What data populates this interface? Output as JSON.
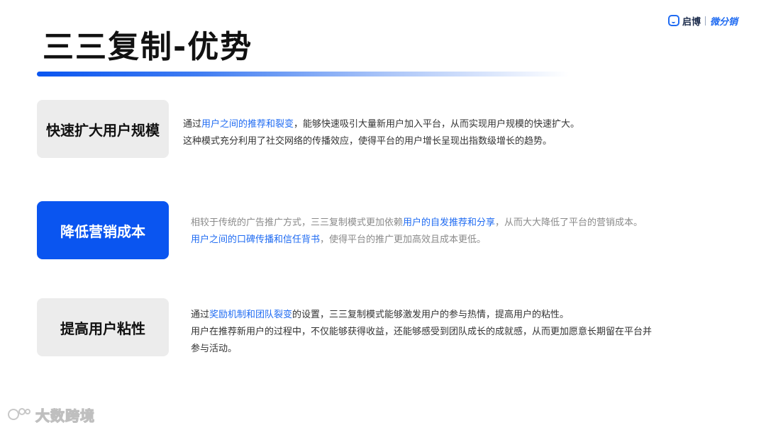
{
  "title": "三三复制-优势",
  "brand": {
    "name": "启博",
    "sub": "微分销"
  },
  "sections": [
    {
      "tag": "快速扩大用户规模",
      "lines": [
        [
          "通过",
          "用户之间的推荐和裂变",
          "，能够快速吸引大量新用户加入平台，从而实现用户规模的快速扩大。"
        ],
        [
          "这种模式充分利用了社交网络的传播效应，使得平台的用户增长呈现出指数级增长的趋势。"
        ]
      ]
    },
    {
      "tag": "降低营销成本",
      "lines": [
        [
          "相较于传统的广告推广方式，三三复制模式更加依赖",
          "用户的自发推荐和分享",
          "，从而大大降低了平台的营销成本。"
        ],
        [
          "",
          "用户之间的口碑传播和信任背书",
          "，使得平台的推广更加高效且成本更低。"
        ]
      ]
    },
    {
      "tag": "提高用户粘性",
      "lines": [
        [
          "通过",
          "奖励机制和团队裂变",
          "的设置，三三复制模式能够激发用户的参与热情，提高用户的粘性。"
        ],
        [
          "用户在推荐新用户的过程中，不仅能够获得收益，还能够感受到团队成长的成就感，从而更加愿意长期留在平台并"
        ],
        [
          "参与活动。"
        ]
      ]
    }
  ],
  "watermark": {
    "text": "大数跨境"
  },
  "colors": {
    "accent": "#0a55f0",
    "highlight": "#1f6bf2",
    "tag_bg": "#ececec"
  }
}
